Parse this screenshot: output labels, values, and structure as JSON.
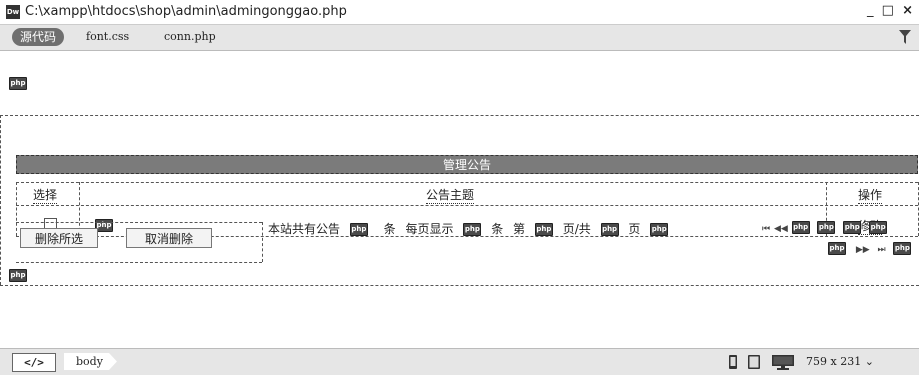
{
  "window": {
    "title": "C:\\xampp\\htdocs\\shop\\admin\\admingonggao.php",
    "logo": "Dw",
    "minimize": "_",
    "maximize": "□",
    "close": "×"
  },
  "tabs": {
    "source": "源代码",
    "files": [
      "font.css",
      "conn.php"
    ]
  },
  "php_badge": "php",
  "table": {
    "title": "管理公告",
    "col_select": "选择",
    "col_subject": "公告主题",
    "col_action": "操作",
    "row_action": "修改"
  },
  "buttons": {
    "delete_selected": "删除所选",
    "cancel_delete": "取消删除"
  },
  "pager": {
    "total_prefix": "本站共有公告",
    "unit": "条",
    "per_page": "每页显示",
    "unit2": "条",
    "page_prefix": "第",
    "page_of": "页/共",
    "page_suffix": "页",
    "first": "⏮",
    "prev": "◀◀",
    "next": "▶▶",
    "last": "⏭"
  },
  "statusbar": {
    "tag_button": "</>",
    "body_tag": "body",
    "size": "759 x 231"
  },
  "icons": {
    "filter": "filter-icon",
    "phone": "mobile-icon",
    "tablet": "tablet-icon",
    "desktop": "desktop-icon"
  }
}
